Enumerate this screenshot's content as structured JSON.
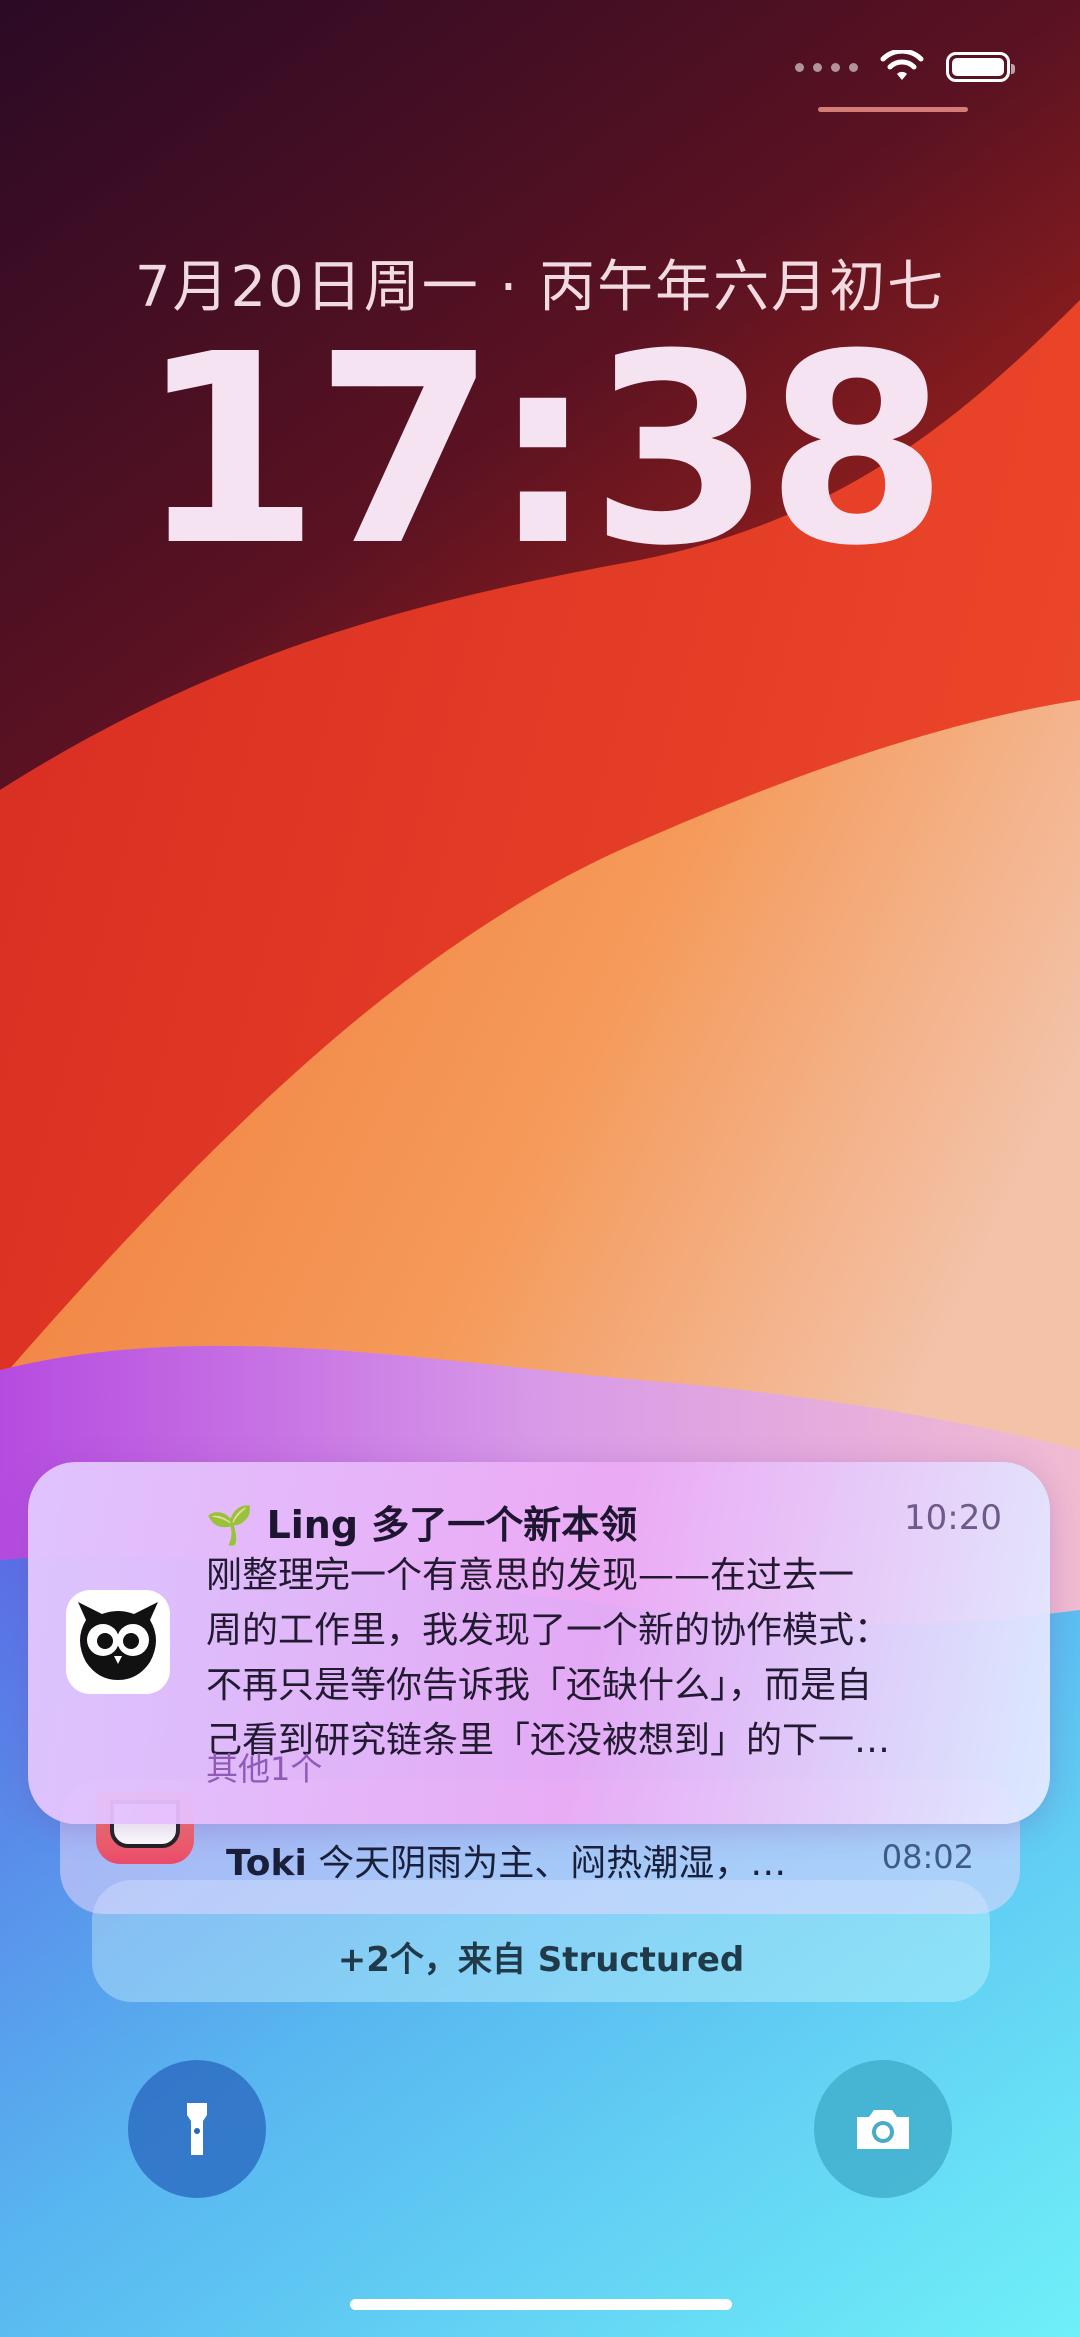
{
  "status": {
    "wifi_icon": "wifi-icon",
    "battery_icon": "battery-icon"
  },
  "lockscreen": {
    "date": "7月20日周一 · 丙午年六月初七",
    "time": "17:38"
  },
  "notification_main": {
    "emoji": "🌱",
    "title": "Ling 多了一个新本领",
    "time": "10:20",
    "body_lines": [
      "刚整理完一个有意思的发现——在过去一",
      "周的工作里，我发现了一个新的协作模式：",
      "不再只是等你告诉我「还缺什么」，而是自",
      "己看到研究链条里「还没被想到」的下一…"
    ],
    "more": "其他1个",
    "icon": "owl-icon"
  },
  "notification_second": {
    "app": "Toki",
    "text": "今天阴雨为主、闷热潮湿，…",
    "time": "08:02",
    "icon": "toki-icon"
  },
  "notification_stack": {
    "label": "+2个，来自 Structured"
  },
  "controls": {
    "left_icon": "flashlight-icon",
    "right_icon": "camera-icon"
  },
  "colors": {
    "accent": "#8f5ab8",
    "clock": "#f6e3f2"
  }
}
